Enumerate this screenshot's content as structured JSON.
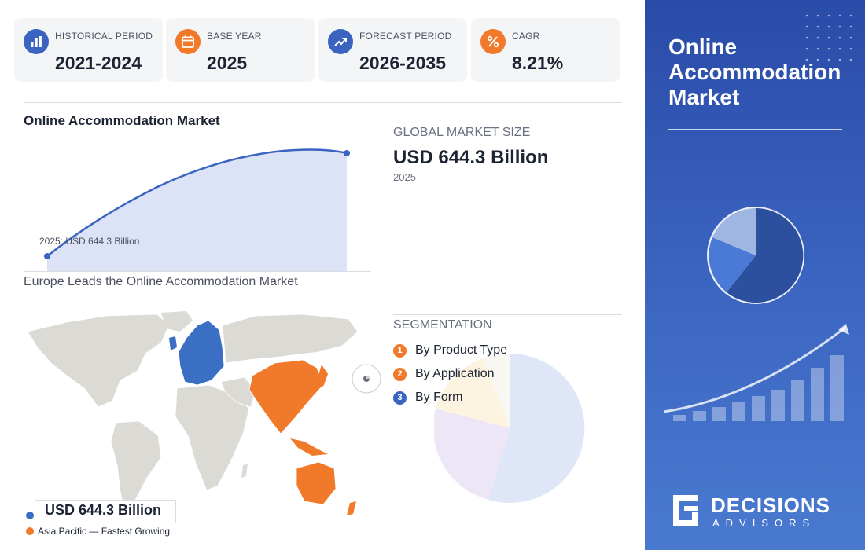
{
  "stats": [
    {
      "label": "HISTORICAL PERIOD",
      "value": "2021-2024",
      "icon": "bar-chart-icon",
      "color": "#3a64c0"
    },
    {
      "label": "BASE YEAR",
      "value": "2025",
      "icon": "calendar-icon",
      "color": "#f07a2a"
    },
    {
      "label": "FORECAST PERIOD",
      "value": "2026-2035",
      "icon": "trend-up-icon",
      "color": "#3a64c0"
    },
    {
      "label": "CAGR",
      "value": "8.21%",
      "icon": "percent-icon",
      "color": "#f07a2a"
    }
  ],
  "growth_chart": {
    "title": "Online Accommodation Market",
    "point_label": "2025: USD 644.3 Billion"
  },
  "global_market": {
    "label": "GLOBAL MARKET SIZE",
    "value": "USD 644.3 Billion",
    "year": "2025"
  },
  "map": {
    "title": "Europe Leads the Online Accommodation Market",
    "callout": "USD 644.3 Billion",
    "legend": "Asia Pacific — Fastest Growing",
    "leading_color": "#3a6fc4",
    "growing_color": "#f07a2a"
  },
  "segmentation": {
    "title": "SEGMENTATION",
    "items": [
      {
        "num": "1",
        "label": "By Product Type",
        "color": "#f07a2a"
      },
      {
        "num": "2",
        "label": "By Application",
        "color": "#f07a2a"
      },
      {
        "num": "3",
        "label": "By Form",
        "color": "#3a64c0"
      }
    ]
  },
  "side_panel": {
    "title": "Online Accommodation Market",
    "brand_name": "DECISIONS",
    "brand_sub": "ADVISORS"
  }
}
